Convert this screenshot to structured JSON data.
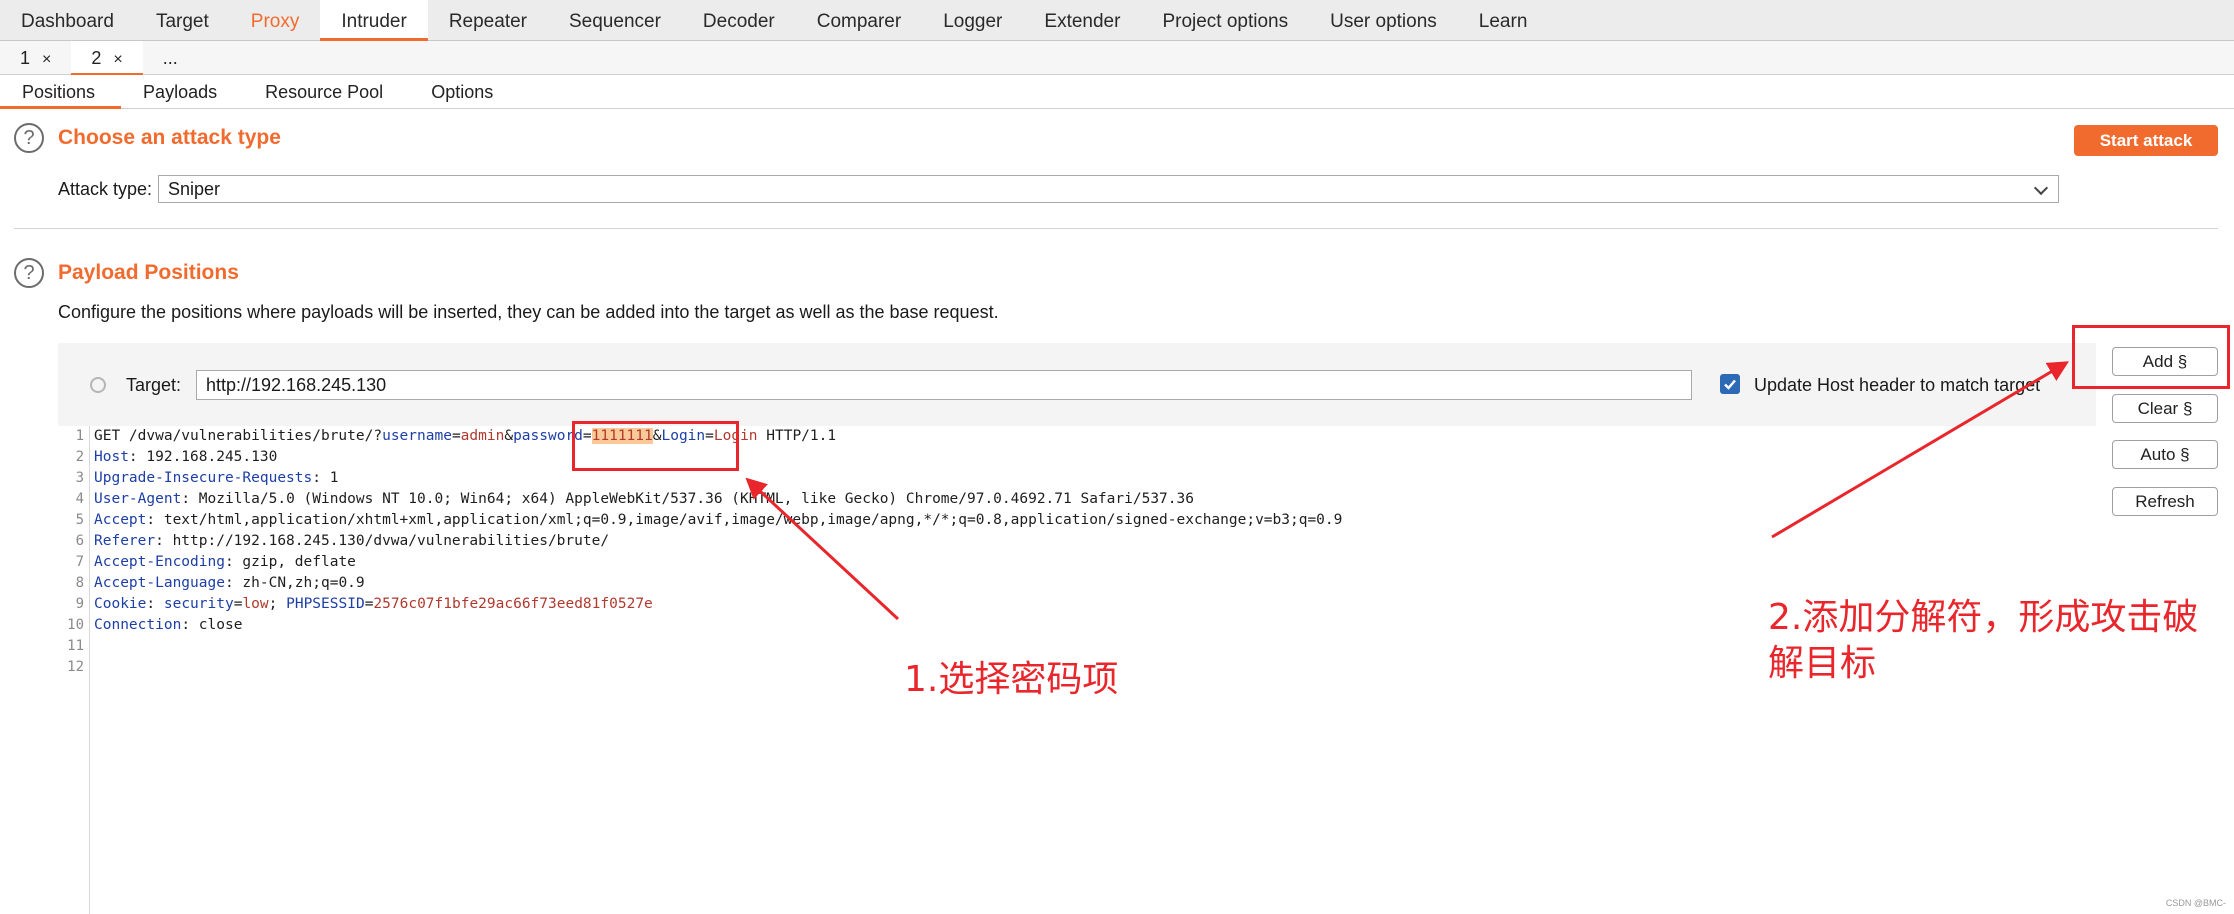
{
  "menu": {
    "tabs": [
      {
        "label": "Dashboard"
      },
      {
        "label": "Target"
      },
      {
        "label": "Proxy"
      },
      {
        "label": "Intruder"
      },
      {
        "label": "Repeater"
      },
      {
        "label": "Sequencer"
      },
      {
        "label": "Decoder"
      },
      {
        "label": "Comparer"
      },
      {
        "label": "Logger"
      },
      {
        "label": "Extender"
      },
      {
        "label": "Project options"
      },
      {
        "label": "User options"
      },
      {
        "label": "Learn"
      }
    ]
  },
  "intruder_tabs": {
    "tabs": [
      {
        "label": "1",
        "close": "×"
      },
      {
        "label": "2",
        "close": "×"
      },
      {
        "label": "..."
      }
    ]
  },
  "option_tabs": {
    "tabs": [
      {
        "label": "Positions"
      },
      {
        "label": "Payloads"
      },
      {
        "label": "Resource Pool"
      },
      {
        "label": "Options"
      }
    ]
  },
  "attack_type": {
    "heading": "Choose an attack type",
    "start_label": "Start attack",
    "field_label": "Attack type:",
    "selected": "Sniper",
    "help": "?"
  },
  "positions": {
    "heading": "Payload Positions",
    "help": "?",
    "description": "Configure the positions where payloads will be inserted, they can be added into the target as well as the base request.",
    "target_label": "Target:",
    "target_value": "http://192.168.245.130",
    "update_host_label": "Update Host header to match target",
    "buttons": {
      "add": "Add §",
      "clear": "Clear §",
      "auto": "Auto §",
      "refresh": "Refresh"
    }
  },
  "request": {
    "line_numbers": [
      "1",
      "2",
      "3",
      "4",
      "5",
      "6",
      "7",
      "8",
      "9",
      "10",
      "11",
      "12"
    ],
    "l1": {
      "method": "GET /dvwa/vulnerabilities/brute/?",
      "k1": "username",
      "eq1": "=",
      "v1": "admin",
      "amp1": "&",
      "k2": "password",
      "eq2": "=",
      "v2": "1111111",
      "amp2": "&",
      "k3": "Login",
      "eq3": "=",
      "v3": "Login",
      "proto": " HTTP/1.1"
    },
    "l2": {
      "k": "Host",
      "v": ": 192.168.245.130"
    },
    "l3": {
      "k": "Upgrade-Insecure-Requests",
      "v": ": 1"
    },
    "l4": {
      "k": "User-Agent",
      "v": ": Mozilla/5.0 (Windows NT 10.0; Win64; x64) AppleWebKit/537.36 (KHTML, like Gecko) Chrome/97.0.4692.71 Safari/537.36"
    },
    "l5": {
      "k": "Accept",
      "v": ": text/html,application/xhtml+xml,application/xml;q=0.9,image/avif,image/webp,image/apng,*/*;q=0.8,application/signed-exchange;v=b3;q=0.9"
    },
    "l6": {
      "k": "Referer",
      "v": ": http://192.168.245.130/dvwa/vulnerabilities/brute/"
    },
    "l7": {
      "k": "Accept-Encoding",
      "v": ": gzip, deflate"
    },
    "l8": {
      "k": "Accept-Language",
      "v": ": zh-CN,zh;q=0.9"
    },
    "l9": {
      "k": "Cookie",
      "sep": ": ",
      "k1": "security",
      "eq1": "=",
      "v1": "low",
      "semi": "; ",
      "k2": "PHPSESSID",
      "eq2": "=",
      "v2": "2576c07f1bfe29ac66f73eed81f0527e"
    },
    "l10": {
      "k": "Connection",
      "v": ": close"
    }
  },
  "annotations": {
    "note1": "1.选择密码项",
    "note2_line1": "2.添加分解符，形成攻击破",
    "note2_line2": "解目标",
    "color": "#e8262b"
  },
  "watermark": "CSDN @BMC-",
  "colors": {
    "accent": "#f26b2e",
    "checkbox": "#2d6ab5",
    "annotation": "#e8262b"
  }
}
